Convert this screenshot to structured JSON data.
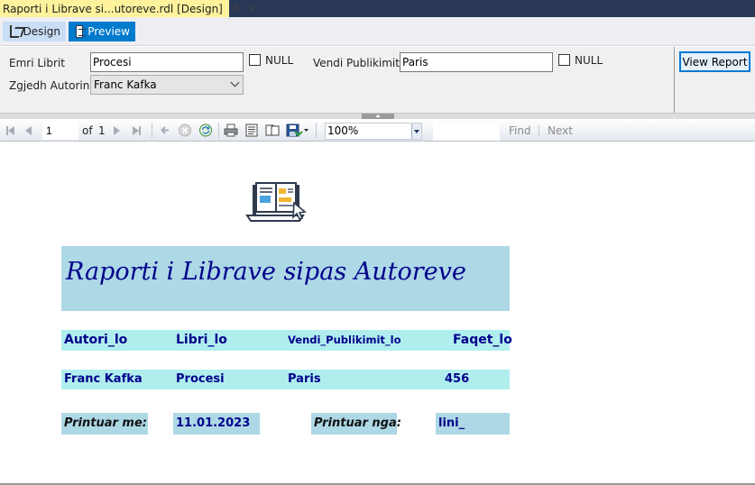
{
  "document_tab": {
    "title": "Raporti i Librave si...utoreve.rdl [Design]",
    "pin_glyph": "⊕",
    "close_glyph": "×"
  },
  "view_switch": {
    "design_label": "Design",
    "preview_label": "Preview",
    "active": "Preview"
  },
  "parameters": {
    "emri_librit_label": "Emri Librit",
    "emri_librit_value": "Procesi",
    "null_label_1": "NULL",
    "vendi_label": "Vendi Publikimit",
    "vendi_value": "Paris",
    "null_label_2": "NULL",
    "autor_label": "Zgjedh Autorin",
    "autor_selected": "Franc Kafka",
    "view_report_label": "View Report"
  },
  "toolbar": {
    "current_page": "1",
    "of_label": "of",
    "total_pages": "1",
    "zoom": "100%",
    "find_label": "Find",
    "next_label": "Next",
    "icons": [
      "first-page-icon",
      "previous-page-icon",
      "next-page-icon",
      "last-page-icon",
      "back-icon",
      "stop-icon",
      "refresh-icon",
      "print-icon",
      "print-layout-icon",
      "page-setup-icon",
      "export-icon"
    ]
  },
  "report": {
    "title": "Raporti i Librave sipas Autoreve",
    "headers": [
      "Autori_lo",
      "Libri_lo",
      "Vendi_Publikimit_lo",
      "Faqet_lo"
    ],
    "row": [
      "Franc Kafka",
      "Procesi",
      "Paris",
      "456"
    ],
    "printed_on_label": "Printuar me:",
    "printed_on_value": "11.01.2023",
    "printed_by_label": "Printuar nga:",
    "printed_by_value": "lini_"
  },
  "colors": {
    "title_bg": "#add8e6",
    "row_bg": "#b0eeee",
    "report_text": "#00008b",
    "accent": "#007acc",
    "tab_active": "#fff29d"
  }
}
